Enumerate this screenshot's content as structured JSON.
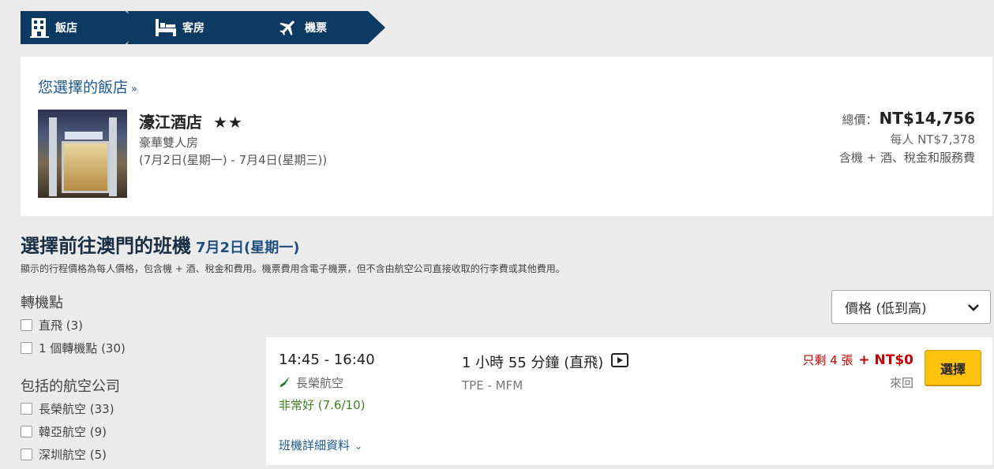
{
  "steps": [
    {
      "label": "飯店",
      "icon": "building-icon"
    },
    {
      "label": "客房",
      "icon": "bed-icon"
    },
    {
      "label": "機票",
      "icon": "airplane-icon"
    }
  ],
  "hotel_card": {
    "heading": "您選擇的飯店",
    "name": "濠江酒店",
    "stars": "★★",
    "room": "豪華雙人房",
    "dates": "(7月2日(星期一) - 7月4日(星期三))",
    "total_label": "總價：",
    "total_value": "NT$14,756",
    "per_person": "每人 NT$7,378",
    "includes": "含機 + 酒、稅金和服務費"
  },
  "flights_section": {
    "title": "選擇前往澳門的班機",
    "date": "7月2日(星期一)",
    "note": "顯示的行程價格為每人價格，包含機 + 酒、稅金和費用。機票費用含電子機票，但不含由航空公司直接收取的行李費或其他費用。"
  },
  "filters": {
    "stops_heading": "轉機點",
    "stops": [
      {
        "label": "直飛 (3)"
      },
      {
        "label": "1 個轉機點 (30)"
      }
    ],
    "airlines_heading": "包括的航空公司",
    "airlines": [
      {
        "label": "長榮航空 (33)"
      },
      {
        "label": "韓亞航空 (9)"
      },
      {
        "label": "深圳航空 (5)"
      }
    ]
  },
  "sort": {
    "selected": "價格 (低到高)"
  },
  "flight_result": {
    "time": "14:45 - 16:40",
    "airline": "長榮航空",
    "rating": "非常好 (7.6/10)",
    "duration": "1 小時 55 分鐘 (直飛)",
    "route": "TPE - MFM",
    "seats_left": "只剩 4 張",
    "price": "+ NT$0",
    "trip_type": "來回",
    "select_label": "選擇",
    "details_link": "班機詳細資料"
  },
  "colors": {
    "step_bg": "#0c3a63",
    "link": "#1f5a8c",
    "price_red": "#c00000",
    "select_btn": "#ffc20e",
    "rating_green": "#3f7f1f"
  }
}
